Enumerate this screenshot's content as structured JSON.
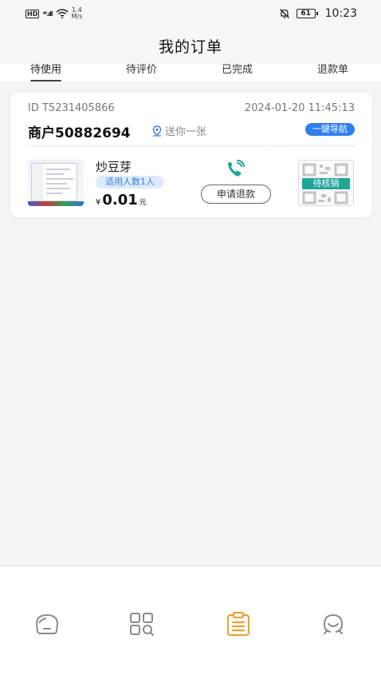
{
  "status_bar": {
    "hd": "HD",
    "signal": "⁴⁶.ıll",
    "speed_value": "1.4",
    "speed_unit": "M/s",
    "battery": "61",
    "time": "10:23"
  },
  "header": {
    "title": "我的订单"
  },
  "tabs": [
    {
      "label": "待使用",
      "active": true
    },
    {
      "label": "待评价",
      "active": false
    },
    {
      "label": "已完成",
      "active": false
    },
    {
      "label": "退款单",
      "active": false
    }
  ],
  "order": {
    "id": "ID T5231405866",
    "datetime": "2024-01-20 11:45:13",
    "merchant": "商户50882694",
    "gift": "送你一张",
    "nav_button": "一键导航",
    "item_name": "炒豆芽",
    "people_tag": "适用人数1人",
    "price_currency": "¥",
    "price_value": "0.01",
    "price_unit": "元",
    "refund_button": "申请退款",
    "status_overlay": "待核销"
  },
  "colors": {
    "accent_blue": "#2f7ff0",
    "teal": "#20a59a",
    "orange": "#f0a030",
    "icon_gray": "#888888"
  },
  "bottom_nav": [
    {
      "icon": "home-icon",
      "active": false
    },
    {
      "icon": "category-search-icon",
      "active": false
    },
    {
      "icon": "orders-icon",
      "active": true
    },
    {
      "icon": "profile-icon",
      "active": false
    }
  ]
}
